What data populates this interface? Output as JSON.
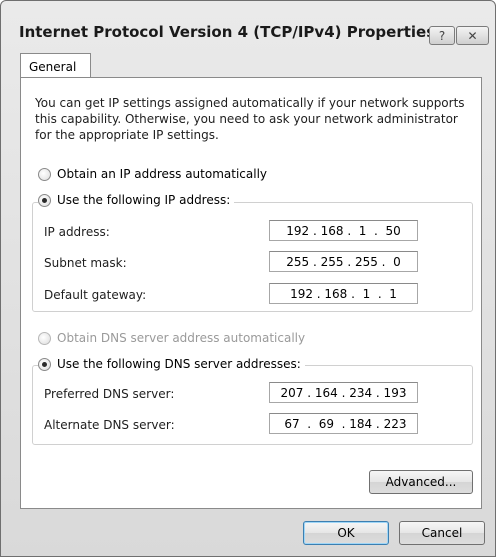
{
  "window": {
    "title": "Internet Protocol Version 4 (TCP/IPv4) Properties",
    "help_glyph": "?",
    "close_glyph": "✕"
  },
  "tabs": [
    {
      "label": "General",
      "active": true
    }
  ],
  "intro_text": "You can get IP settings assigned automatically if your network supports this capability. Otherwise, you need to ask your network administrator for the appropriate IP settings.",
  "ip": {
    "obtain_auto_label": "Obtain an IP address automatically",
    "use_following_label": "Use the following IP address:",
    "selected": "use_following",
    "fields": [
      {
        "label": "IP address:",
        "value": "192 . 168 .  1  .  50"
      },
      {
        "label": "Subnet mask:",
        "value": "255 . 255 . 255 .  0"
      },
      {
        "label": "Default gateway:",
        "value": "192 . 168 .  1  .  1"
      }
    ]
  },
  "dns": {
    "obtain_auto_label": "Obtain DNS server address automatically",
    "obtain_auto_enabled": false,
    "use_following_label": "Use the following DNS server addresses:",
    "selected": "use_following",
    "fields": [
      {
        "label": "Preferred DNS server:",
        "value": "207 . 164 . 234 . 193"
      },
      {
        "label": "Alternate DNS server:",
        "value": " 67  .  69  . 184 . 223"
      }
    ]
  },
  "buttons": {
    "advanced": "Advanced...",
    "ok": "OK",
    "cancel": "Cancel"
  },
  "icons": {
    "radio_checked": "radio-checked-icon",
    "radio_unchecked": "radio-unchecked-icon"
  }
}
